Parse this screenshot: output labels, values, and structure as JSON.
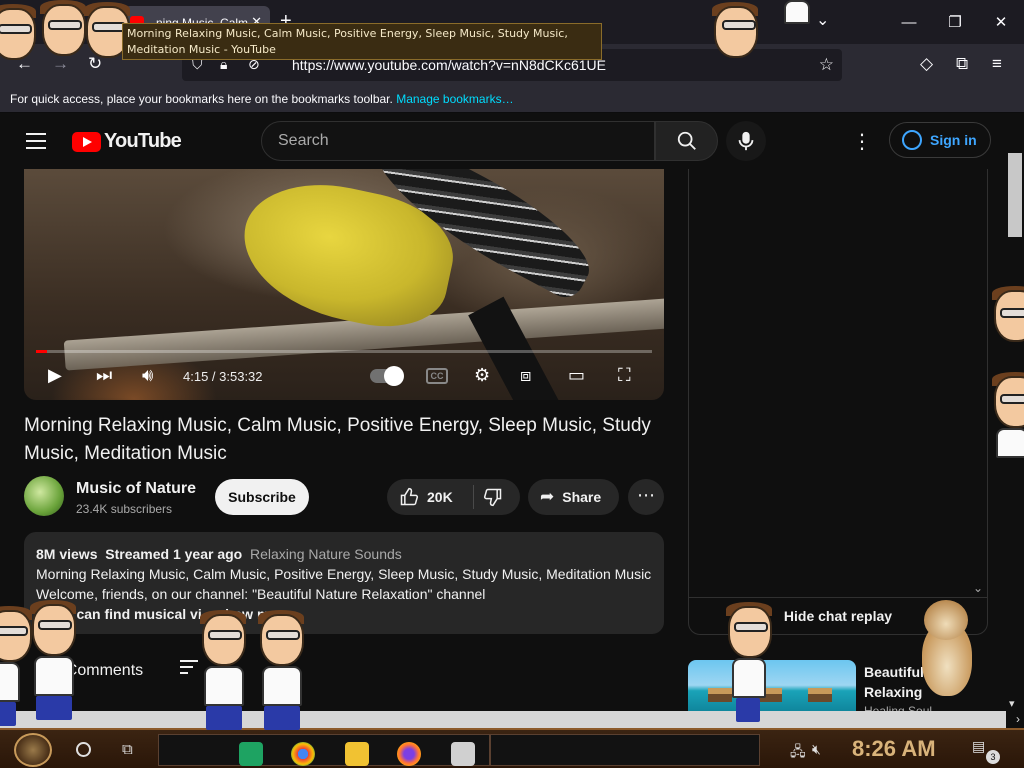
{
  "browser": {
    "tab_title": "...ning Music, Calm",
    "tooltip": "Morning Relaxing Music, Calm Music, Positive Energy, Sleep Music, Study Music, Meditation Music - YouTube",
    "url": "https://www.youtube.com/watch?v=nN8dCKc61UE",
    "bookmarks_text": "For quick access, place your bookmarks here on the bookmarks toolbar.",
    "bookmarks_link": "Manage bookmarks…"
  },
  "youtube": {
    "logo_text": "YouTube",
    "search_placeholder": "Search",
    "sign_in": "Sign in",
    "player": {
      "time": "4:15 / 3:53:32",
      "progress_fraction": 0.018
    },
    "video_title": "Morning Relaxing Music, Calm Music, Positive Energy, Sleep Music, Study Music, Meditation Music",
    "channel_name": "Music of Nature",
    "subscribers": "23.4K subscribers",
    "subscribe": "Subscribe",
    "likes": "20K",
    "share": "Share",
    "description": {
      "views": "8M views",
      "streamed": "Streamed 1 year ago",
      "tag": "Relaxing Nature Sounds",
      "line1": "Morning Relaxing Music, Calm Music, Positive Energy, Sleep Music, Study Music, Meditation Music",
      "line2": "Welcome, friends, on our channel: \"Beautiful Nature Relaxation\" channel",
      "line3": "...you can find musical vi",
      "show_more": "...show more"
    },
    "comments_label": "Comments",
    "comments_count": "1,",
    "hide_chat": "Hide chat replay",
    "recommended": {
      "title_line1": "Beautiful",
      "title_line2": "Relaxing",
      "channel": "Healing Soul..."
    }
  },
  "taskbar": {
    "clock": "8:26 AM",
    "notifications": "3"
  },
  "colors": {
    "youtube_red": "#ff0000",
    "link_blue": "#3ea6ff",
    "bookmark_link": "#00ddff",
    "clock": "#d9b37a"
  }
}
